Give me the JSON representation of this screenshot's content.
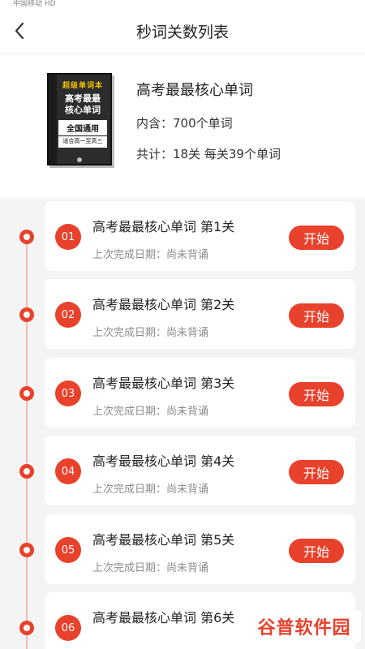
{
  "status": {
    "carrier": "中国移动 HD"
  },
  "header": {
    "title": "秒词关数列表"
  },
  "book": {
    "cover": {
      "brand": "超级单词本",
      "title": "高考最最核心单词",
      "band": "全国通用",
      "sub": "适合高一至高三"
    },
    "name": "高考最最核心单词",
    "count": "内含：700个单词",
    "levels": "共计：18关 每关39个单词"
  },
  "levels": [
    {
      "num": "01",
      "name": "高考最最核心单词 第1关",
      "date": "上次完成日期：尚未背诵",
      "action": "开始"
    },
    {
      "num": "02",
      "name": "高考最最核心单词 第2关",
      "date": "上次完成日期：尚未背诵",
      "action": "开始"
    },
    {
      "num": "03",
      "name": "高考最最核心单词 第3关",
      "date": "上次完成日期：尚未背诵",
      "action": "开始"
    },
    {
      "num": "04",
      "name": "高考最最核心单词 第4关",
      "date": "上次完成日期：尚未背诵",
      "action": "开始"
    },
    {
      "num": "05",
      "name": "高考最最核心单词 第5关",
      "date": "上次完成日期：尚未背诵",
      "action": "开始"
    },
    {
      "num": "06",
      "name": "高考最最核心单词 第6关",
      "date": "",
      "action": ""
    }
  ],
  "watermark": {
    "text": "谷普软件园"
  },
  "colors": {
    "accent": "#e8412c",
    "background": "#f4f4f4",
    "timeline": "#f0bcb4"
  }
}
